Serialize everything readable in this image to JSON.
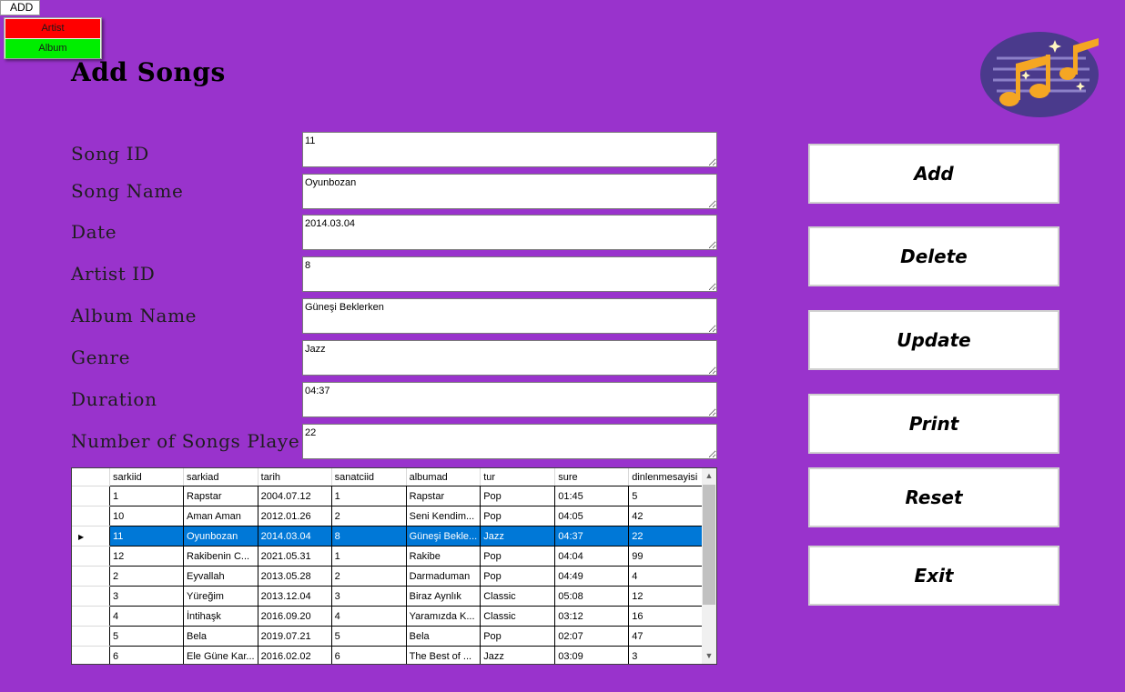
{
  "menu": {
    "add_label": "ADD",
    "items": [
      {
        "label": "Artist",
        "color": "#ff0000"
      },
      {
        "label": "Album",
        "color": "#00ee00"
      }
    ]
  },
  "title": "Add Songs",
  "fields": [
    {
      "label": "Song ID",
      "value": "11"
    },
    {
      "label": "Song Name",
      "value": "Oyunbozan"
    },
    {
      "label": "Date",
      "value": "2014.03.04"
    },
    {
      "label": "Artist ID",
      "value": "8"
    },
    {
      "label": "Album Name",
      "value": "Güneşi Beklerken"
    },
    {
      "label": "Genre",
      "value": "Jazz"
    },
    {
      "label": "Duration",
      "value": "04:37"
    },
    {
      "label": "Number of Songs Playe",
      "value": "22"
    }
  ],
  "buttons": [
    "Add",
    "Delete",
    "Update",
    "Print",
    "Reset",
    "Exit"
  ],
  "grid": {
    "columns": [
      "sarkiid",
      "sarkiad",
      "tarih",
      "sanatciid",
      "albumad",
      "tur",
      "sure",
      "dinlenmesayisi"
    ],
    "selected_row": 2,
    "rows": [
      [
        "1",
        "Rapstar",
        "2004.07.12",
        "1",
        "Rapstar",
        "Pop",
        "01:45",
        "5"
      ],
      [
        "10",
        "Aman Aman",
        "2012.01.26",
        "2",
        "Seni Kendim...",
        "Pop",
        "04:05",
        "42"
      ],
      [
        "11",
        "Oyunbozan",
        "2014.03.04",
        "8",
        "Güneşi Bekle...",
        "Jazz",
        "04:37",
        "22"
      ],
      [
        "12",
        "Rakibenin C...",
        "2021.05.31",
        "1",
        "Rakibe",
        "Pop",
        "04:04",
        "99"
      ],
      [
        "2",
        "Eyvallah",
        "2013.05.28",
        "2",
        "Darmaduman",
        "Pop",
        "04:49",
        "4"
      ],
      [
        "3",
        "Yüreğim",
        "2013.12.04",
        "3",
        "Biraz Aynlık",
        "Classic",
        "05:08",
        "12"
      ],
      [
        "4",
        "İntihaşk",
        "2016.09.20",
        "4",
        "Yaramızda K...",
        "Classic",
        "03:12",
        "16"
      ],
      [
        "5",
        "Bela",
        "2019.07.21",
        "5",
        "Bela",
        "Pop",
        "02:07",
        "47"
      ],
      [
        "6",
        "Ele Güne Kar...",
        "2016.02.02",
        "6",
        "The Best of ...",
        "Jazz",
        "03:09",
        "3"
      ]
    ]
  },
  "colors": {
    "background": "#9933cc",
    "selection": "#0078d7"
  },
  "icons": {
    "logo": "music-notes-icon",
    "row_pointer": "triangle-right-icon"
  }
}
